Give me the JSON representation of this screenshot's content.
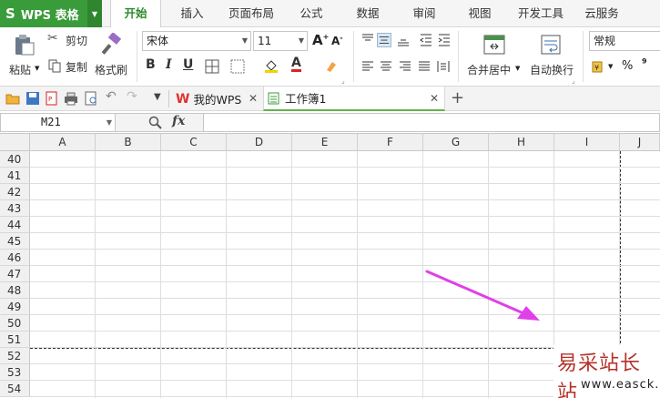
{
  "app": {
    "name": "WPS 表格",
    "logo_glyph": "S",
    "brand_color": "#3a9b3a"
  },
  "menu": {
    "tabs": [
      {
        "label": "开始"
      },
      {
        "label": "插入"
      },
      {
        "label": "页面布局"
      },
      {
        "label": "公式"
      },
      {
        "label": "数据"
      },
      {
        "label": "审阅"
      },
      {
        "label": "视图"
      },
      {
        "label": "开发工具"
      },
      {
        "label": "云服务"
      }
    ],
    "active": "开始"
  },
  "ribbon": {
    "paste": "粘贴",
    "cut": "剪切",
    "copy": "复制",
    "format_painter": "格式刷",
    "font_name": "宋体",
    "font_size": "11",
    "bold": "B",
    "italic": "I",
    "underline": "U",
    "font_color_glyph": "A",
    "grow_font": "A",
    "shrink_font": "A",
    "merge_center": "合并居中",
    "wrap_text": "自动换行",
    "number_format": "常规",
    "percent": "%",
    "comma": "⁹"
  },
  "quickbar": {
    "doc_tabs": [
      {
        "label": "我的WPS"
      },
      {
        "label": "工作簿1"
      }
    ],
    "active_tab": "工作簿1"
  },
  "formula_bar": {
    "name_box": "M21",
    "fx": "fx",
    "formula": ""
  },
  "sheet": {
    "columns": [
      "A",
      "B",
      "C",
      "D",
      "E",
      "F",
      "G",
      "H",
      "I",
      "J"
    ],
    "rows": [
      "40",
      "41",
      "42",
      "43",
      "44",
      "45",
      "46",
      "47",
      "48",
      "49",
      "50",
      "51",
      "52",
      "53",
      "54"
    ],
    "annotation_color": "#e040e8"
  },
  "watermark": {
    "text": "易采站长站",
    "url": "www.easck.com"
  }
}
